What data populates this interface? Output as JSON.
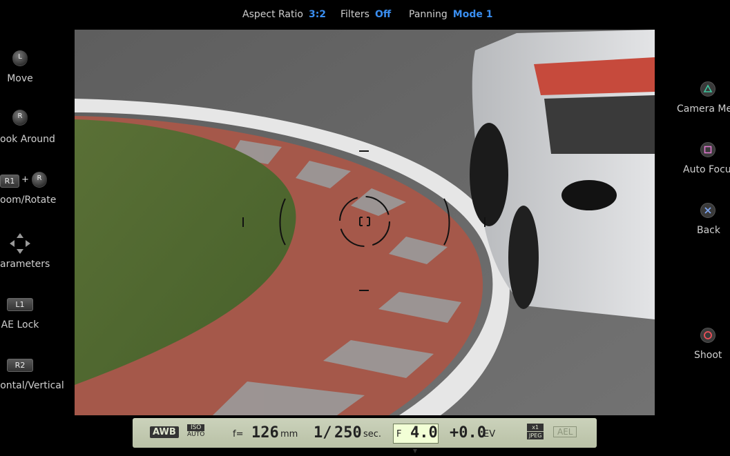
{
  "top_bar": {
    "aspect_label": "Aspect Ratio",
    "aspect_value": "3:2",
    "filters_label": "Filters",
    "filters_value": "Off",
    "panning_label": "Panning",
    "panning_value": "Mode 1"
  },
  "left_controls": {
    "move": {
      "button": "L",
      "label": "Move"
    },
    "look": {
      "button": "R",
      "label": "ook Around"
    },
    "zoom": {
      "button1": "R1",
      "plus": "+",
      "button2": "R",
      "label": "oom/Rotate"
    },
    "params": {
      "label": "arameters"
    },
    "ae_lock": {
      "button": "L1",
      "label": "AE Lock"
    },
    "orient": {
      "button": "R2",
      "label": "ontal/Vertical"
    }
  },
  "right_controls": {
    "camera_menu": {
      "label": "Camera Men",
      "icon": "triangle-icon"
    },
    "auto_focus": {
      "label": "Auto Focu",
      "icon": "square-icon"
    },
    "back": {
      "label": "Back",
      "icon": "cross-icon"
    },
    "shoot": {
      "label": "Shoot",
      "icon": "circle-icon"
    }
  },
  "lcd": {
    "awb": "AWB",
    "iso_badge": "ISO",
    "iso_value": "AUTO",
    "focal_prefix": "f=",
    "focal_value": "126",
    "focal_unit": "mm",
    "shutter_prefix": "1/",
    "shutter_value": "250",
    "shutter_unit": "sec.",
    "aperture_prefix": "F",
    "aperture_value": "4.0",
    "ev_value": "+0.0",
    "ev_unit": "EV",
    "mult": "x1",
    "format": "JPEG",
    "ael": "AEL"
  },
  "colors": {
    "accent": "#3a8ef0",
    "lcd_bg": "#c4cbb1"
  }
}
